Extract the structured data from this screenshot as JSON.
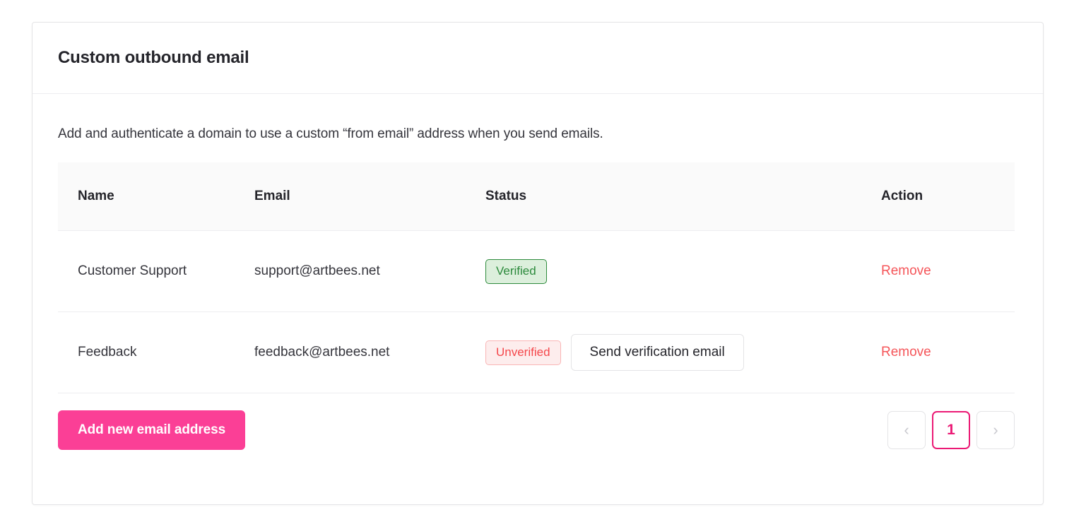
{
  "card": {
    "title": "Custom outbound email",
    "description": "Add and authenticate a domain to use a custom “from email” address when you send emails."
  },
  "table": {
    "headers": {
      "name": "Name",
      "email": "Email",
      "status": "Status",
      "action": "Action"
    },
    "rows": [
      {
        "name": "Customer Support",
        "email": "support@artbees.net",
        "status": "Verified",
        "status_type": "verified",
        "action": "Remove",
        "has_verify_button": false,
        "verify_button": ""
      },
      {
        "name": "Feedback",
        "email": "feedback@artbees.net",
        "status": "Unverified",
        "status_type": "unverified",
        "action": "Remove",
        "has_verify_button": true,
        "verify_button": "Send verification email"
      }
    ]
  },
  "footer": {
    "add_button": "Add new email address",
    "pagination": {
      "prev": "‹",
      "next": "›",
      "current_page": "1"
    }
  },
  "colors": {
    "accent_pink": "#fb3f96",
    "active_page_pink": "#eb1a75",
    "remove_red": "#f5565a",
    "verified_green": "#2c8a3c",
    "verified_bg": "#dcefdc",
    "unverified_red": "#f5484c",
    "unverified_bg": "#fdeded",
    "border_gray": "#e4e4e6",
    "header_bg": "#fafafa",
    "text_dark": "#25252b"
  }
}
